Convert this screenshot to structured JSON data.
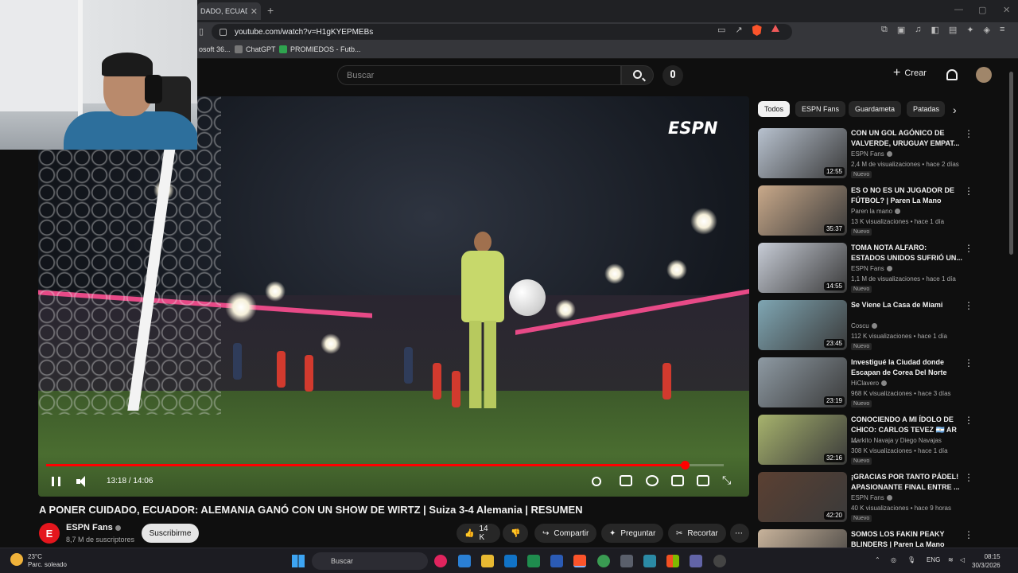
{
  "browser": {
    "tab_title": "DADO, ECUADO",
    "url": "youtube.com/watch?v=H1gKYEPMEBs",
    "bookmarks": [
      "osoft 36...",
      "ChatGPT",
      "PROMIEDOS - Futb..."
    ]
  },
  "youtube": {
    "search_placeholder": "Buscar",
    "create_label": "Crear"
  },
  "player": {
    "overlay_logo": "ESPN",
    "time": "13:18 / 14:06",
    "progress_fraction": 0.943
  },
  "video": {
    "title": "A PONER CUIDADO, ECUADOR: ALEMANIA GANÓ CON UN SHOW DE WIRTZ | Suiza 3-4 Alemania | RESUMEN",
    "channel": "ESPN Fans",
    "subscribers": "8,7 M de suscriptores",
    "subscribe_label": "Suscribirme",
    "likes": "14 K",
    "share_label": "Compartir",
    "ask_label": "Preguntar",
    "clip_label": "Recortar"
  },
  "chips": [
    "Todos",
    "ESPN Fans",
    "Guardameta",
    "Patadas"
  ],
  "recommendations": [
    {
      "title": "CON UN GOL AGÓNICO DE VALVERDE, URUGUAY EMPAT...",
      "channel": "ESPN Fans",
      "meta": "2,4 M de visualizaciones • hace 2 días",
      "badge": "Nuevo",
      "duration": "12:55",
      "thumb_color": "#b8c2cf",
      "verified": true
    },
    {
      "title": "ES O NO ES UN JUGADOR DE FÚTBOL? | Paren La Mano",
      "channel": "Paren la mano",
      "meta": "13 K visualizaciones • hace 1 día",
      "badge": "Nuevo",
      "duration": "35:37",
      "thumb_color": "#c9a98a",
      "verified": true
    },
    {
      "title": "TOMA NOTA ALFARO: ESTADOS UNIDOS SUFRIÓ UN...",
      "channel": "ESPN Fans",
      "meta": "1,1 M de visualizaciones • hace 1 día",
      "badge": "Nuevo",
      "duration": "14:55",
      "thumb_color": "#c7ccd6",
      "verified": true
    },
    {
      "title": "Se Viene La Casa de Miami",
      "channel": "Coscu",
      "meta": "112 K visualizaciones • hace 1 día",
      "badge": "Nuevo",
      "duration": "23:45",
      "thumb_color": "#7fa6b3",
      "verified": true
    },
    {
      "title": "Investigué la Ciudad donde Escapan de Corea Del Norte",
      "channel": "HiClavero",
      "meta": "968 K visualizaciones • hace 3 días",
      "badge": "Nuevo",
      "duration": "23:19",
      "thumb_color": "#8e9aa3",
      "verified": true
    },
    {
      "title": "CONOCIENDO A MI ÍDOLO DE CHICO: CARLOS TEVEZ 🇦🇷 AR ...",
      "channel": "Markito Navaja y Diego Navajas",
      "meta": "308 K visualizaciones • hace 1 día",
      "badge": "Nuevo",
      "duration": "32:16",
      "thumb_color": "#a7b36d",
      "verified": false
    },
    {
      "title": "¡GRACIAS POR TANTO PÁDEL! APASIONANTE FINAL ENTRE ...",
      "channel": "ESPN Fans",
      "meta": "40 K visualizaciones • hace 9 horas",
      "badge": "Nuevo",
      "duration": "42:20",
      "thumb_color": "#5b4032",
      "verified": true
    },
    {
      "title": "SOMOS LOS FAKIN PEAKY BLINDERS | Paren La Mano",
      "channel": "",
      "meta": "",
      "badge": "",
      "duration": "",
      "thumb_color": "#c8b39b",
      "verified": false
    }
  ],
  "taskbar": {
    "temperature": "23°C",
    "weather": "Parc. soleado",
    "search_label": "Buscar",
    "language": "ENG",
    "time": "08:15",
    "date": "30/3/2026"
  }
}
